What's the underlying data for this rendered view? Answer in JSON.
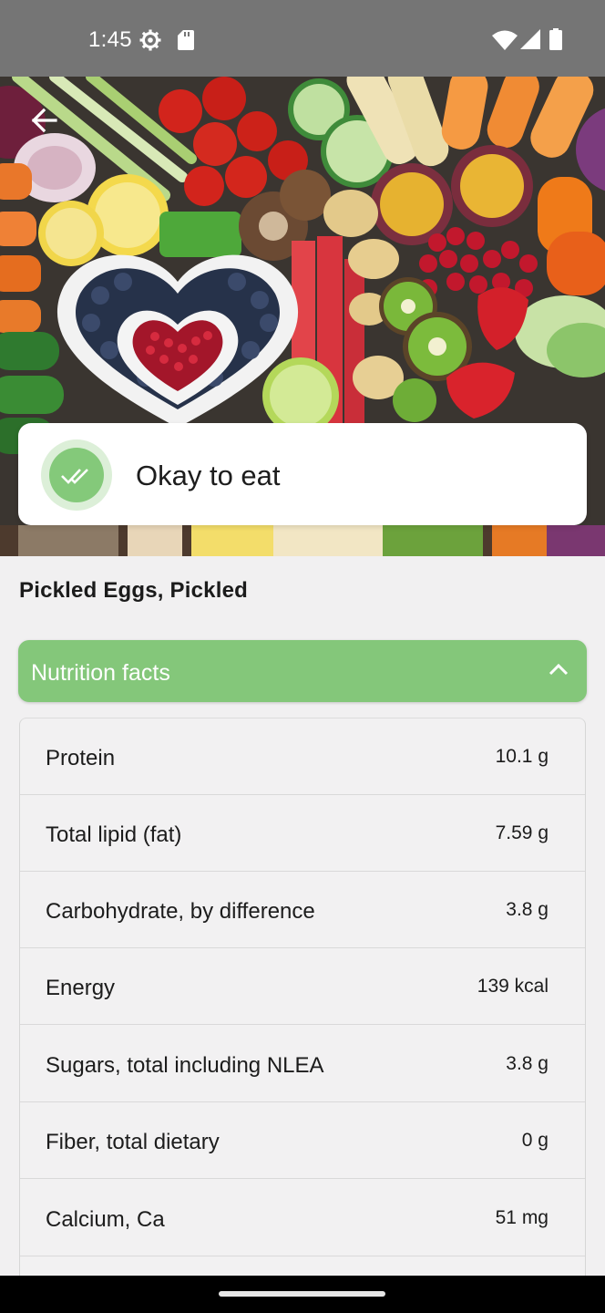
{
  "status_bar": {
    "time": "1:45",
    "icons": [
      "gear-icon",
      "sd-card-icon",
      "wifi-icon",
      "signal-icon",
      "battery-icon"
    ]
  },
  "hero": {
    "image": "assorted-fresh-vegetables-and-fruits-photo",
    "back_icon": "arrow-left-icon"
  },
  "status_card": {
    "label": "Okay to eat",
    "icon": "double-check-icon",
    "color": "#84c97a"
  },
  "food": {
    "name": "Pickled Eggs, Pickled"
  },
  "nutrition": {
    "header": "Nutrition facts",
    "header_color": "#84c77a",
    "expanded_icon": "chevron-up-icon",
    "rows": [
      {
        "name": "Protein",
        "value": "10.1 g"
      },
      {
        "name": "Total lipid (fat)",
        "value": "7.59 g"
      },
      {
        "name": "Carbohydrate, by difference",
        "value": "3.8 g"
      },
      {
        "name": "Energy",
        "value": "139 kcal"
      },
      {
        "name": "Sugars, total including NLEA",
        "value": "3.8 g"
      },
      {
        "name": "Fiber, total dietary",
        "value": "0 g"
      },
      {
        "name": "Calcium, Ca",
        "value": "51 mg"
      }
    ]
  }
}
